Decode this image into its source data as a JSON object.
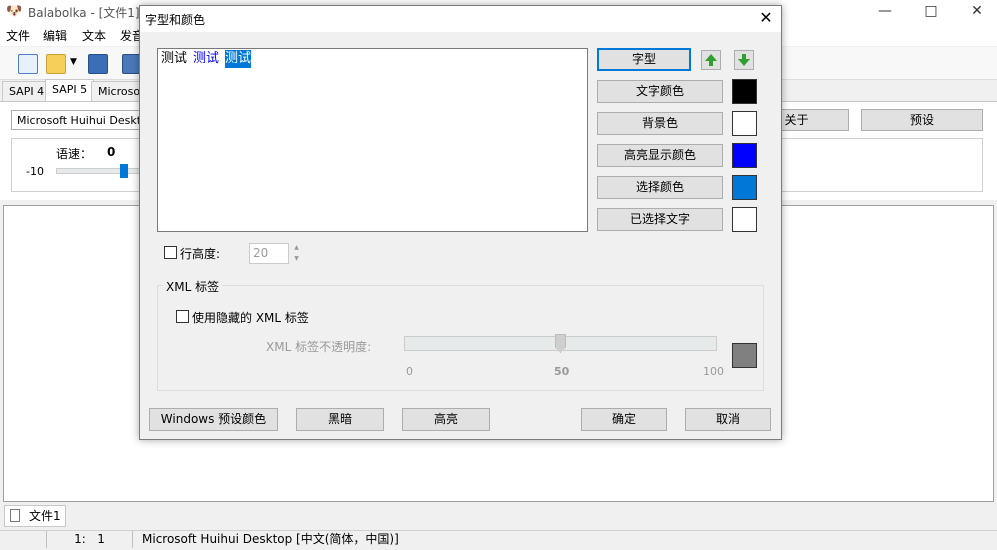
{
  "main_window": {
    "title": "Balabolka - [文件1]",
    "menu": [
      "文件",
      "编辑",
      "文本",
      "发音"
    ],
    "voice_tabs": [
      "SAPI 4",
      "SAPI 5",
      "Microsoft"
    ],
    "voice_select": "Microsoft Huihui Desktop",
    "about_button": "关于",
    "preset_button": "预设",
    "rate_label": "语速：",
    "rate_value": "0",
    "rate_min": "-10",
    "doc_tab": "文件1",
    "status_position": "1:   1",
    "status_voice": "Microsoft Huihui Desktop [中文(简体，中国)]"
  },
  "dialog": {
    "title": "字型和颜色",
    "preview": {
      "normal": "测试",
      "highlight": "测试",
      "selected": "测试"
    },
    "font_button": "字型",
    "color_rows": [
      {
        "label": "文字颜色",
        "color": "#000000"
      },
      {
        "label": "背景色",
        "color": "#ffffff"
      },
      {
        "label": "高亮显示颜色",
        "color": "#0000ff"
      },
      {
        "label": "选择颜色",
        "color": "#0078d7"
      },
      {
        "label": "已选择文字",
        "color": "#ffffff"
      }
    ],
    "line_height_label": "行高度:",
    "line_height_value": "20",
    "xml_group_title": "XML 标签",
    "use_hidden_xml_label": "使用隐藏的 XML 标签",
    "xml_opacity_label": "XML 标签不透明度:",
    "slider": {
      "value": 50,
      "min_label": "0",
      "mid_label": "50",
      "max_label": "100"
    },
    "opacity_color": "#808080",
    "bottom_buttons": {
      "windows_preset": "Windows 预设颜色",
      "dark": "黑暗",
      "bright": "高亮",
      "ok": "确定",
      "cancel": "取消"
    }
  }
}
